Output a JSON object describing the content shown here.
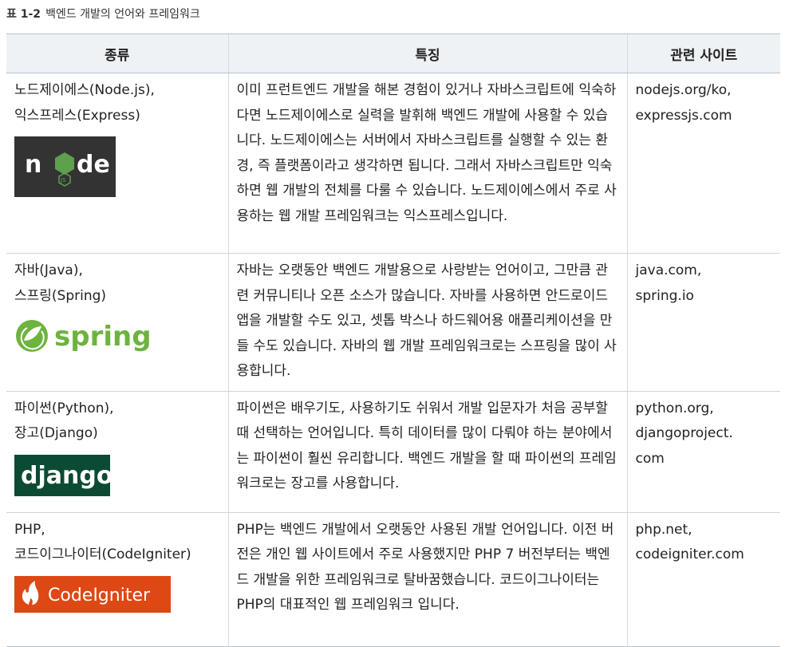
{
  "caption": {
    "label": "표 1-2",
    "title": "백엔드 개발의 언어와 프레임워크"
  },
  "headers": {
    "type": "종류",
    "features": "특징",
    "site": "관련 사이트"
  },
  "rows": [
    {
      "name_line1": "노드제이에스(Node.js),",
      "name_line2": "익스프레스(Express)",
      "logo": "node-logo",
      "logo_text": "node",
      "logo_sub": "JS",
      "description": "이미 프런트엔드 개발을 해본 경험이 있거나 자바스크립트에 익숙하다면 노드제이에스로 실력을 발휘해 백엔드 개발에 사용할 수 있습니다. 노드제이에스는 서버에서 자바스크립트를 실행할 수 있는 환경, 즉 플랫폼이라고 생각하면 됩니다. 그래서 자바스크립트만 익숙하면 웹 개발의 전체를 다룰 수 있습니다. 노드제이에스에서 주로 사용하는 웹 개발 프레임워크는 익스프레스입니다.",
      "site_line1": "nodejs.org/ko,",
      "site_line2": "expressjs.com",
      "colors": {
        "bg": "#333333",
        "green": "#5fa04e"
      }
    },
    {
      "name_line1": "자바(Java),",
      "name_line2": "스프링(Spring)",
      "logo": "spring-logo",
      "logo_text": "spring",
      "description": "자바는 오랫동안 백엔드 개발용으로 사랑받는 언어이고, 그만큼 관련 커뮤니티나 오픈 소스가 많습니다. 자바를 사용하면 안드로이드 앱을 개발할 수도 있고, 셋톱 박스나 하드웨어용 애플리케이션을 만들 수도 있습니다. 자바의 웹 개발 프레임워크로는 스프링을 많이 사용합니다.",
      "site_line1": "java.com,",
      "site_line2": "spring.io",
      "colors": {
        "green": "#6db33f"
      }
    },
    {
      "name_line1": "파이썬(Python),",
      "name_line2": "장고(Django)",
      "logo": "django-logo",
      "logo_text": "django",
      "description": "파이썬은 배우기도, 사용하기도 쉬워서 개발 입문자가 처음 공부할 때 선택하는 언어입니다. 특히 데이터를 많이 다뤄야 하는 분야에서는 파이썬이 훨씬 유리합니다. 백엔드 개발을 할 때 파이썬의 프레임워크로는 장고를 사용합니다.",
      "site_line1": "python.org,",
      "site_line2": "djangoproject.",
      "site_line3": "com",
      "colors": {
        "bg": "#0c4b33"
      }
    },
    {
      "name_line1": "PHP,",
      "name_line2": "코드이그나이터(CodeIgniter)",
      "logo": "codeigniter-logo",
      "logo_text": "CodeIgniter",
      "description": "PHP는 백엔드 개발에서 오랫동안 사용된 개발 언어입니다. 이전 버전은 개인 웹 사이트에서 주로 사용했지만 PHP 7 버전부터는 백엔드 개발을 위한 프레임워크로 탈바꿈했습니다. 코드이그나이터는 PHP의 대표적인 웹 프레임워크 입니다.",
      "site_line1": "php.net,",
      "site_line2": "codeigniter.com",
      "colors": {
        "bg": "#dd4814"
      }
    }
  ]
}
